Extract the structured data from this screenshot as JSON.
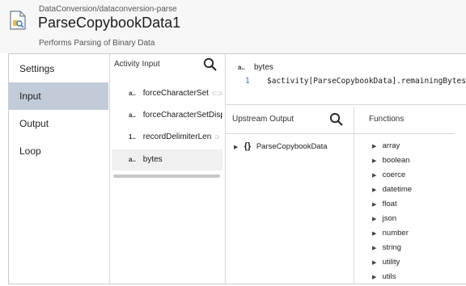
{
  "header": {
    "breadcrumb": "DataConversion/dataconversion-parse",
    "title": "ParseCopybookData1",
    "subtitle": "Performs Parsing of Binary Data"
  },
  "nav": {
    "items": [
      {
        "label": "Settings"
      },
      {
        "label": "Input"
      },
      {
        "label": "Output"
      },
      {
        "label": "Loop"
      }
    ],
    "active": "Input"
  },
  "activity_input": {
    "title": "Activity Input",
    "fields": [
      {
        "type": "a..",
        "name": "forceCharacterSet"
      },
      {
        "type": "a..",
        "name": "forceCharacterSetDisp"
      },
      {
        "type": "1..",
        "name": "recordDelimiterLen"
      },
      {
        "type": "a..",
        "name": "bytes"
      }
    ]
  },
  "editor": {
    "field_type": "a..",
    "field_name": "bytes",
    "line_number": "1",
    "expression": "$activity[ParseCopybookData].remainingBytes"
  },
  "upstream_output": {
    "title": "Upstream Output",
    "items": [
      {
        "icon": "{}",
        "label": "ParseCopybookData"
      }
    ]
  },
  "functions": {
    "title": "Functions",
    "items": [
      "array",
      "boolean",
      "coerce",
      "datetime",
      "float",
      "json",
      "number",
      "string",
      "utility",
      "utils"
    ]
  },
  "colors": {
    "nav_active_bg": "#c2ccd9",
    "line_number": "#2f6fd6"
  }
}
